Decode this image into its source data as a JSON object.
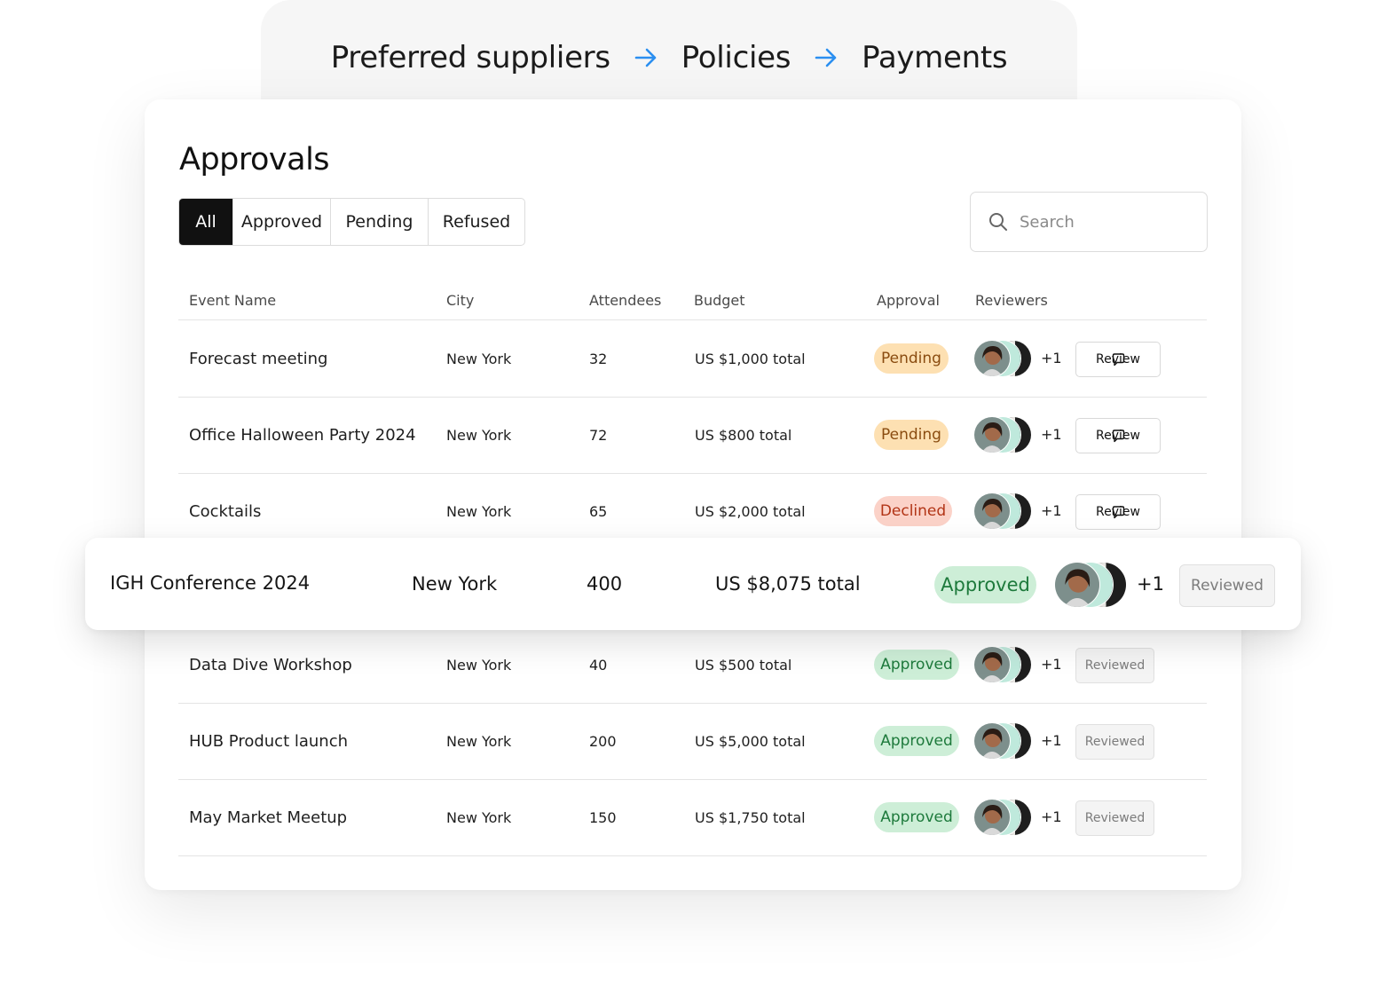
{
  "breadcrumbs": [
    "Preferred suppliers",
    "Policies",
    "Payments"
  ],
  "page_title": "Approvals",
  "filter_tabs": [
    "All",
    "Approved",
    "Pending",
    "Refused"
  ],
  "active_tab": "All",
  "search": {
    "placeholder": "Search",
    "value": ""
  },
  "table": {
    "columns": [
      "Event Name",
      "City",
      "Attendees",
      "Budget",
      "Approval",
      "Reviewers"
    ],
    "rows": [
      {
        "name": "Forecast meeting",
        "city": "New York",
        "attendees": "32",
        "budget": "US $1,000 total",
        "status": "Pending",
        "extra_reviewers": "+1",
        "action": "Review"
      },
      {
        "name": "Office Halloween Party 2024",
        "city": "New York",
        "attendees": "72",
        "budget": "US $800 total",
        "status": "Pending",
        "extra_reviewers": "+1",
        "action": "Review"
      },
      {
        "name": "Cocktails",
        "city": "New York",
        "attendees": "65",
        "budget": "US $2,000 total",
        "status": "Declined",
        "extra_reviewers": "+1",
        "action": "Review"
      },
      {
        "name": "IGH Conference 2024",
        "city": "New York",
        "attendees": "400",
        "budget": "US $8,075 total",
        "status": "Approved",
        "extra_reviewers": "+1",
        "action": "Reviewed"
      },
      {
        "name": "Data Dive Workshop",
        "city": "New York",
        "attendees": "40",
        "budget": "US $500 total",
        "status": "Approved",
        "extra_reviewers": "+1",
        "action": "Reviewed"
      },
      {
        "name": "HUB Product launch",
        "city": "New York",
        "attendees": "200",
        "budget": "US $5,000 total",
        "status": "Approved",
        "extra_reviewers": "+1",
        "action": "Reviewed"
      },
      {
        "name": "May Market Meetup",
        "city": "New York",
        "attendees": "150",
        "budget": "US $1,750 total",
        "status": "Approved",
        "extra_reviewers": "+1",
        "action": "Reviewed"
      }
    ]
  },
  "colors": {
    "accent_arrow": "#2b8ff0",
    "pending_bg": "#fde0b2",
    "pending_text": "#8a4c10",
    "declined_bg": "#fbd2c8",
    "declined_text": "#b23416",
    "approved_bg": "#cdeed7",
    "approved_text": "#1e7a3c"
  },
  "icons": {
    "breadcrumb_separator": "arrow-right-icon",
    "search": "search-icon",
    "review": "chat-bubble-icon"
  }
}
